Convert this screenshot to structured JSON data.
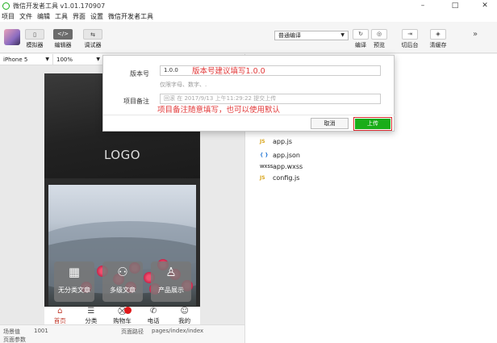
{
  "window": {
    "title": "微信开发者工具 v1.01.170907",
    "minimize": "–",
    "maximize": "□",
    "close": "✕"
  },
  "menu": [
    "项目",
    "文件",
    "编辑",
    "工具",
    "界面",
    "设置",
    "微信开发者工具"
  ],
  "toolbar": {
    "simulator": {
      "label": "模拟器",
      "icon": "phone-icon"
    },
    "editor": {
      "label": "编辑器",
      "icon": "code-icon",
      "glyph": "</>"
    },
    "debugger": {
      "label": "调试器",
      "icon": "debug-icon",
      "glyph": "⇆"
    },
    "compile_mode": "普通编译",
    "compile_label": "编译",
    "preview_label": "预览",
    "backend_label": "切后台",
    "cache_label": "清缓存",
    "collapse_glyph": "»",
    "compile_glyph": "↻",
    "preview_glyph": "◎",
    "backend_glyph": "⇥",
    "cache_glyph": "◈"
  },
  "device": {
    "name": "iPhone 5",
    "zoom": "100%"
  },
  "simulator_page": {
    "logo_text": "LOGO",
    "categories": [
      {
        "label": "无分类文章",
        "icon": "grid-icon",
        "glyph": "▦"
      },
      {
        "label": "多级文章",
        "icon": "users-icon",
        "glyph": "⚇"
      },
      {
        "label": "产品展示",
        "icon": "person-icon",
        "glyph": "♙"
      }
    ],
    "tabs": [
      {
        "label": "首页",
        "glyph": "⌂"
      },
      {
        "label": "分类",
        "glyph": "☰"
      },
      {
        "label": "购物车",
        "glyph": "⛒"
      },
      {
        "label": "电话",
        "glyph": "✆"
      },
      {
        "label": "我的",
        "glyph": "☺"
      }
    ]
  },
  "status": {
    "scene_label": "场景值",
    "scene_value": "1001",
    "path_label": "页面路径",
    "path_value": "pages/index/index",
    "params_label": "页面参数"
  },
  "files": [
    {
      "name": "app.js",
      "type": "JS"
    },
    {
      "name": "app.json",
      "type": "{ }"
    },
    {
      "name": "app.wxss",
      "type": "WXSS"
    },
    {
      "name": "config.js",
      "type": "JS"
    }
  ],
  "upload_dialog": {
    "version_label": "版本号",
    "version_value": "1.0.0",
    "version_hint": "仅限字母、数字、.",
    "note_label": "项目备注",
    "note_placeholder": "回滚 在 2017/9/13 上午11:29:22 提交上传",
    "cancel": "取消",
    "upload": "上传"
  },
  "annotations": {
    "version": "版本号建议填写1.0.0",
    "note": "项目备注随意填写，也可以使用默认"
  },
  "colors": {
    "accent": "#1aad19",
    "annotation": "#e23a3a",
    "active_tab": "#c0392b"
  }
}
